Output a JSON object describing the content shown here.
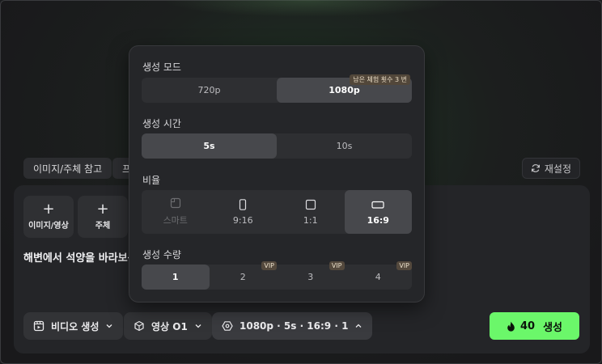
{
  "chips": [
    "이미지/주체 참고",
    "프"
  ],
  "reset_label": "재설정",
  "tiles": [
    {
      "plus": "+",
      "label": "이미지/영상"
    },
    {
      "plus": "+",
      "label": "주체"
    }
  ],
  "prompt_text": "해변에서 석양을 바라보는",
  "bottom_bar": {
    "mode_label": "비디오 생성",
    "model_label": "영상 O1",
    "settings_label": "1080p · 5s · 16:9 · 1",
    "generate_cost": "40",
    "generate_label": "생성"
  },
  "popover": {
    "mode": {
      "title": "생성 모드",
      "options": [
        "720p",
        "1080p"
      ],
      "selected": "1080p",
      "trial_badge": "남은 체험 횟수 3 번"
    },
    "duration": {
      "title": "생성 시간",
      "options": [
        "5s",
        "10s"
      ],
      "selected": "5s"
    },
    "ratio": {
      "title": "비율",
      "options": [
        "스마트",
        "9:16",
        "1:1",
        "16:9"
      ],
      "selected": "16:9"
    },
    "count": {
      "title": "생성 수량",
      "options": [
        "1",
        "2",
        "3",
        "4"
      ],
      "selected": "1",
      "vip_label": "VIP"
    }
  },
  "colors": {
    "accent": "#6bf76a",
    "background": "#1b1c1e",
    "panel": "#242528",
    "vip_badge": "#54493d"
  }
}
